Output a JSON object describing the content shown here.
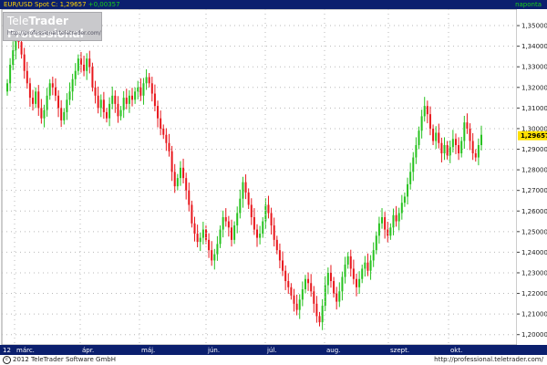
{
  "header": {
    "symbol": "EUR/USD Spot",
    "quote_label": "C: 1,29657",
    "change": "+0,00357",
    "period": "naponta"
  },
  "logo": {
    "brand_part1": "Tele",
    "brand_part2": "Trader Professional",
    "url": "http://professional.teletrader.com/"
  },
  "footer": {
    "copyright": "2012 TeleTrader Software GmbH",
    "site": "http://professional.teletrader.com/"
  },
  "colors": {
    "up": "#27c21f",
    "down": "#e8171c",
    "axis_bg": "#0b1f6e",
    "grid": "#b8b8b8",
    "last_price_box": "#ffe000"
  },
  "chart_data": {
    "type": "candlestick",
    "title": "EUR/USD Spot",
    "period": "daily",
    "ylim": [
      1.195,
      1.358
    ],
    "y_ticks": [
      "1,20000",
      "1,21000",
      "1,22000",
      "1,23000",
      "1,24000",
      "1,25000",
      "1,26000",
      "1,27000",
      "1,28000",
      "1,29000",
      "1,30000",
      "1,31000",
      "1,32000",
      "1,33000",
      "1,34000",
      "1,35000"
    ],
    "y_tick_values": [
      1.2,
      1.21,
      1.22,
      1.23,
      1.24,
      1.25,
      1.26,
      1.27,
      1.28,
      1.29,
      1.3,
      1.31,
      1.32,
      1.33,
      1.34,
      1.35
    ],
    "x_labels": [
      "12",
      "márc.",
      "ápr.",
      "máj.",
      "jún.",
      "júl.",
      "aug.",
      "szept.",
      "okt."
    ],
    "last_price_label": "1,29657",
    "last_price": 1.29657,
    "grid": true,
    "closes": [
      1.322,
      1.331,
      1.338,
      1.347,
      1.342,
      1.336,
      1.328,
      1.322,
      1.315,
      1.312,
      1.318,
      1.31,
      1.305,
      1.309,
      1.316,
      1.322,
      1.32,
      1.316,
      1.31,
      1.304,
      1.308,
      1.314,
      1.318,
      1.324,
      1.328,
      1.334,
      1.331,
      1.328,
      1.334,
      1.33,
      1.32,
      1.316,
      1.31,
      1.314,
      1.308,
      1.305,
      1.312,
      1.316,
      1.312,
      1.306,
      1.309,
      1.315,
      1.312,
      1.316,
      1.314,
      1.318,
      1.32,
      1.316,
      1.322,
      1.325,
      1.322,
      1.317,
      1.311,
      1.305,
      1.3,
      1.297,
      1.293,
      1.289,
      1.279,
      1.272,
      1.276,
      1.281,
      1.276,
      1.27,
      1.263,
      1.254,
      1.249,
      1.245,
      1.247,
      1.251,
      1.246,
      1.241,
      1.236,
      1.239,
      1.244,
      1.251,
      1.257,
      1.255,
      1.252,
      1.246,
      1.253,
      1.259,
      1.266,
      1.274,
      1.269,
      1.263,
      1.257,
      1.251,
      1.247,
      1.249,
      1.255,
      1.263,
      1.259,
      1.253,
      1.246,
      1.241,
      1.236,
      1.231,
      1.226,
      1.223,
      1.219,
      1.215,
      1.212,
      1.217,
      1.222,
      1.227,
      1.225,
      1.221,
      1.215,
      1.209,
      1.206,
      1.214,
      1.224,
      1.23,
      1.226,
      1.22,
      1.216,
      1.221,
      1.228,
      1.234,
      1.238,
      1.232,
      1.227,
      1.223,
      1.227,
      1.232,
      1.235,
      1.231,
      1.236,
      1.241,
      1.248,
      1.254,
      1.257,
      1.251,
      1.248,
      1.252,
      1.258,
      1.255,
      1.259,
      1.264,
      1.267,
      1.273,
      1.279,
      1.286,
      1.292,
      1.299,
      1.306,
      1.311,
      1.307,
      1.3,
      1.294,
      1.298,
      1.293,
      1.288,
      1.292,
      1.287,
      1.291,
      1.295,
      1.292,
      1.288,
      1.294,
      1.303,
      1.3,
      1.294,
      1.288,
      1.286,
      1.292,
      1.297
    ]
  }
}
